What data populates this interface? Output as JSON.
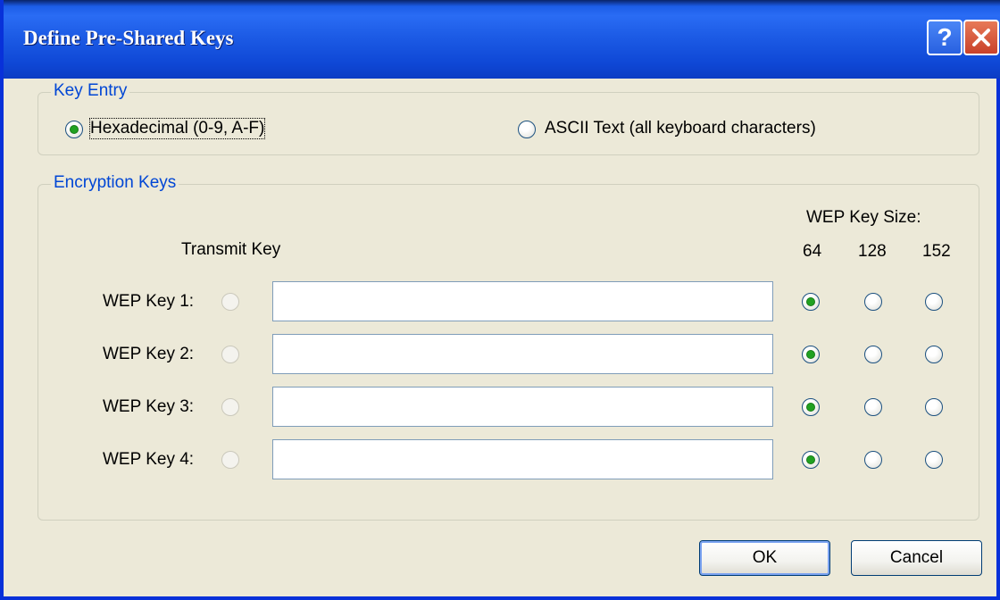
{
  "dialog": {
    "title": "Define Pre-Shared Keys",
    "help_label": "?",
    "close_label": "✕"
  },
  "key_entry": {
    "legend": "Key Entry",
    "options": [
      {
        "label": "Hexadecimal (0-9, A-F)",
        "selected": true
      },
      {
        "label": "ASCII Text (all keyboard characters)",
        "selected": false
      }
    ]
  },
  "encryption": {
    "legend": "Encryption Keys",
    "transmit_key_header": "Transmit Key",
    "size_header": "WEP Key Size:",
    "sizes": [
      "64",
      "128",
      "152"
    ],
    "keys": [
      {
        "label": "WEP Key 1:",
        "value": "",
        "size": "64"
      },
      {
        "label": "WEP Key 2:",
        "value": "",
        "size": "64"
      },
      {
        "label": "WEP Key 3:",
        "value": "",
        "size": "64"
      },
      {
        "label": "WEP Key 4:",
        "value": "",
        "size": "64"
      }
    ]
  },
  "buttons": {
    "ok": "OK",
    "cancel": "Cancel"
  },
  "colors": {
    "title_bar": "#0a5ae0",
    "group_label": "#0046d5",
    "radio_check": "#21a121"
  }
}
